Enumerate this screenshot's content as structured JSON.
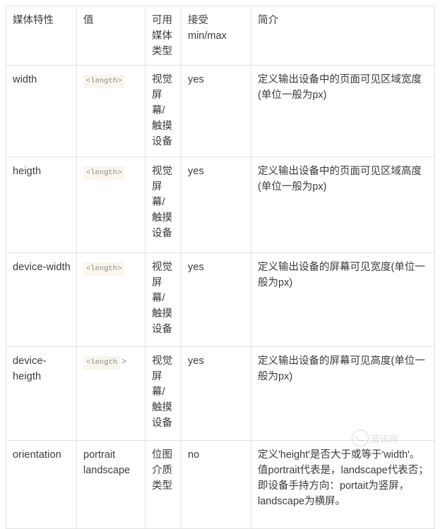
{
  "table": {
    "headers": [
      "媒体特性",
      "值",
      "可用\n媒体\n类型",
      "接受\nmin/max",
      "简介"
    ],
    "header_feature": "媒体特性",
    "header_value": "值",
    "header_media_line1": "可用",
    "header_media_line2": "媒体",
    "header_media_line3": "类型",
    "header_minmax_line1": "接受",
    "header_minmax_line2": "min/max",
    "header_desc": "简介",
    "rows": [
      {
        "feature": "width",
        "value_token": "<length>",
        "value_tail": "",
        "value_is_code": true,
        "media_type": "视觉屏幕/触摸设备",
        "minmax": "yes",
        "description": "定义输出设备中的页面可见区域宽度(单位一般为px)"
      },
      {
        "feature": "heigth",
        "value_token": "<length>",
        "value_tail": "",
        "value_is_code": true,
        "media_type": "视觉屏幕/触摸设备",
        "minmax": "yes",
        "description": "定义输出设备中的页面可见区域高度(单位一般为px)"
      },
      {
        "feature": "device-width",
        "value_token": "<length>",
        "value_tail": "",
        "value_is_code": true,
        "media_type": "视觉屏幕/触摸设备",
        "minmax": "yes",
        "description": "定义输出设备的屏幕可见宽度(单位一般为px)"
      },
      {
        "feature": "device-heigth",
        "value_token": "<length",
        "value_tail": ">",
        "value_is_code": true,
        "media_type": "视觉屏幕/触摸设备",
        "minmax": "yes",
        "description": "定义输出设备的屏幕可见高度(单位一般为px)"
      },
      {
        "feature": "orientation",
        "value_token": "portrait landscape",
        "value_tail": "",
        "value_is_code": false,
        "media_type": "位图介质类型",
        "minmax": "no",
        "description": "定义'height'是否大于或等于'width'。值portrait代表是，landscape代表否；即设备手持方向：portait为竖屏，landscape为横屏。"
      }
    ]
  },
  "watermark": {
    "text": "蓝讯网",
    "logo": "circle-smile-logo"
  },
  "colors": {
    "border": "#e2e2e2",
    "text": "#3b3b3b",
    "code_background": "#faf5ec",
    "code_text": "#8a8a8a"
  }
}
